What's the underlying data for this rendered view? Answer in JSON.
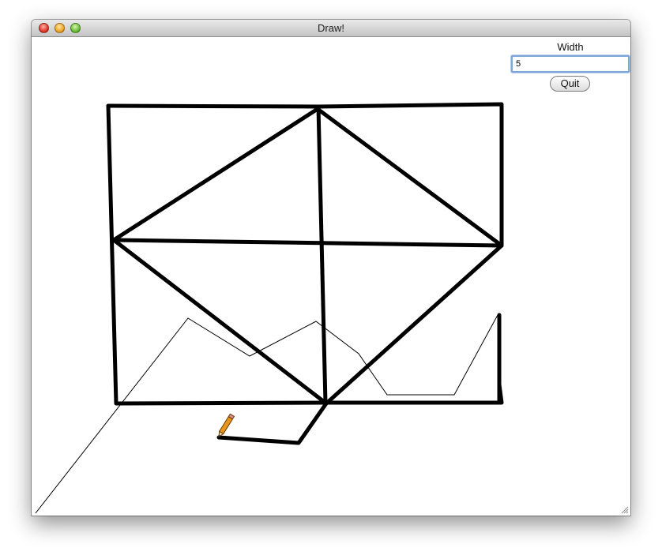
{
  "window": {
    "title": "Draw!"
  },
  "controls": {
    "width_label": "Width",
    "width_value": "5",
    "quit_label": "Quit"
  },
  "icons": {
    "close": "close-icon",
    "minimize": "minimize-icon",
    "zoom": "zoom-icon",
    "pencil": "pencil-icon",
    "resize": "resize-grip-icon"
  }
}
